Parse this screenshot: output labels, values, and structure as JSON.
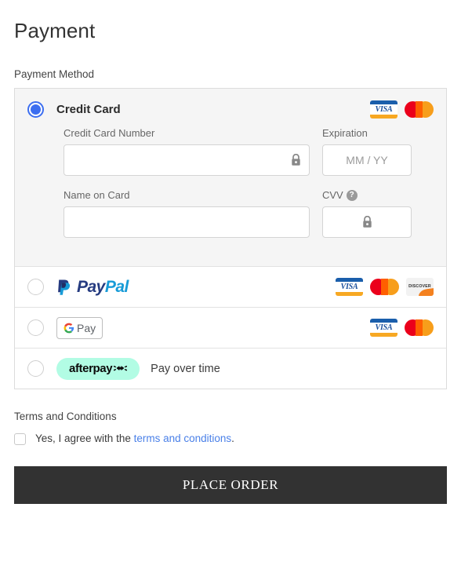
{
  "page": {
    "title": "Payment"
  },
  "payment_method": {
    "label": "Payment Method",
    "selected": "credit_card",
    "methods": [
      {
        "id": "credit_card",
        "label": "Credit Card",
        "brands": [
          "visa",
          "mastercard"
        ]
      },
      {
        "id": "paypal",
        "label": "PayPal",
        "logo_pay": "Pay",
        "logo_pal": "Pal",
        "brands": [
          "visa",
          "mastercard",
          "discover"
        ]
      },
      {
        "id": "gpay",
        "label": "Pay",
        "brands": [
          "visa",
          "mastercard"
        ]
      },
      {
        "id": "afterpay",
        "label": "afterpay",
        "tagline": "Pay over time"
      }
    ]
  },
  "credit_card_form": {
    "card_number": {
      "label": "Credit Card Number",
      "value": "",
      "placeholder": ""
    },
    "expiration": {
      "label": "Expiration",
      "value": "",
      "placeholder": "MM / YY"
    },
    "name_on_card": {
      "label": "Name on Card",
      "value": "",
      "placeholder": ""
    },
    "cvv": {
      "label": "CVV",
      "help": "?",
      "value": "",
      "placeholder": ""
    }
  },
  "brand_text": {
    "visa": "VISA",
    "discover": "DISCOVER"
  },
  "terms": {
    "title": "Terms and Conditions",
    "checked": false,
    "text_before": "Yes, I agree with the ",
    "link_text": "terms and conditions",
    "text_after": "."
  },
  "actions": {
    "place_order": "PLACE ORDER"
  },
  "colors": {
    "accent_blue": "#3c6ef0",
    "link_blue": "#4a80e8",
    "button_dark": "#323232",
    "visa_blue": "#1a5eab",
    "visa_gold": "#f7a823",
    "mastercard_red": "#eb001b",
    "mastercard_yellow": "#f79e1b",
    "discover_orange": "#f4811f",
    "afterpay_mint": "#b2fce4",
    "panel_gray": "#f5f5f5"
  }
}
